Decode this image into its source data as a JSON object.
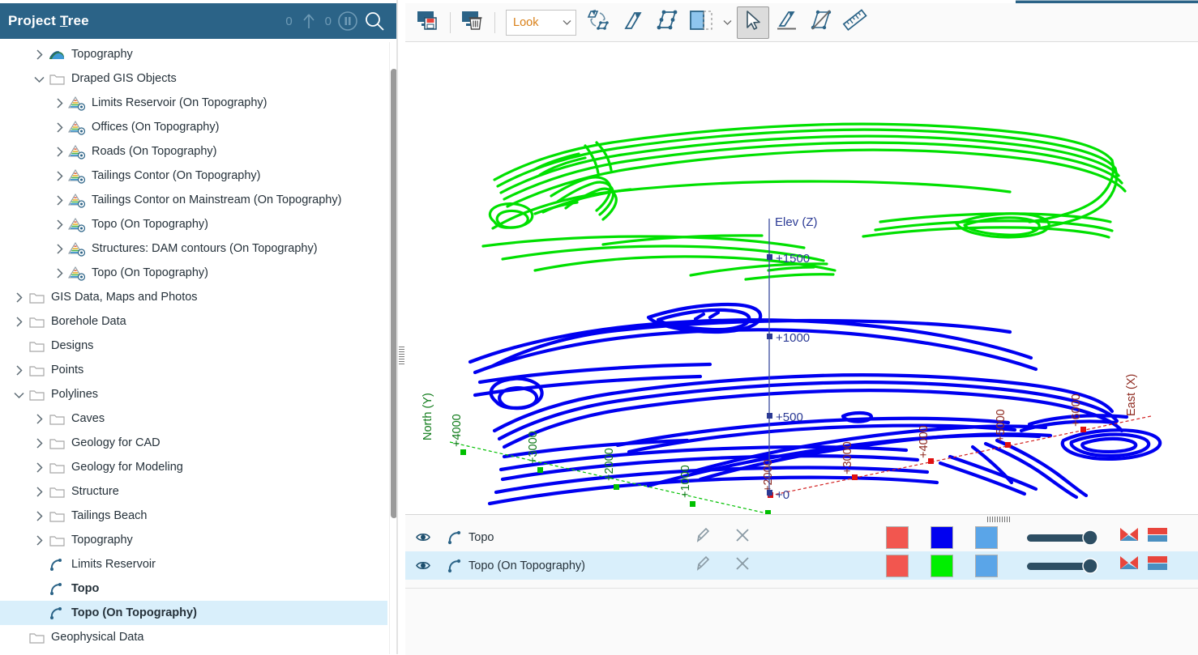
{
  "window": {
    "panel_title": "Project Tree",
    "panel_title_accel": "T"
  },
  "project_tree": {
    "counters": {
      "up_count": "0",
      "pause_count": "0"
    },
    "header_icons": [
      "upload-icon",
      "pause-icon",
      "search-icon"
    ],
    "items": [
      {
        "label": "Topography",
        "icon": "topography-icon",
        "indent": 1,
        "expander": "collapsed",
        "bold": false,
        "selected": false
      },
      {
        "label": "Draped GIS Objects",
        "icon": "folder-icon",
        "indent": 1,
        "expander": "expanded",
        "bold": false,
        "selected": false
      },
      {
        "label": "Limits Reservoir (On Topography)",
        "icon": "draped-gis-icon",
        "indent": 2,
        "expander": "collapsed",
        "bold": false,
        "selected": false
      },
      {
        "label": "Offices (On Topography)",
        "icon": "draped-gis-icon",
        "indent": 2,
        "expander": "collapsed",
        "bold": false,
        "selected": false
      },
      {
        "label": "Roads (On Topography)",
        "icon": "draped-gis-icon",
        "indent": 2,
        "expander": "collapsed",
        "bold": false,
        "selected": false
      },
      {
        "label": "Tailings Contor (On Topography)",
        "icon": "draped-gis-icon",
        "indent": 2,
        "expander": "collapsed",
        "bold": false,
        "selected": false
      },
      {
        "label": "Tailings Contor on Mainstream (On Topography)",
        "icon": "draped-gis-icon",
        "indent": 2,
        "expander": "collapsed",
        "bold": false,
        "selected": false
      },
      {
        "label": "Topo (On Topography)",
        "icon": "draped-gis-icon",
        "indent": 2,
        "expander": "collapsed",
        "bold": false,
        "selected": false
      },
      {
        "label": "Structures: DAM contours (On Topography)",
        "icon": "draped-gis-icon",
        "indent": 2,
        "expander": "collapsed",
        "bold": false,
        "selected": false
      },
      {
        "label": "Topo (On Topography)",
        "icon": "draped-gis-icon",
        "indent": 2,
        "expander": "collapsed",
        "bold": false,
        "selected": false
      },
      {
        "label": "GIS Data, Maps and Photos",
        "icon": "folder-icon",
        "indent": 0,
        "expander": "collapsed",
        "bold": false,
        "selected": false
      },
      {
        "label": "Borehole Data",
        "icon": "folder-icon",
        "indent": 0,
        "expander": "collapsed",
        "bold": false,
        "selected": false
      },
      {
        "label": "Designs",
        "icon": "folder-icon",
        "indent": 0,
        "expander": "none",
        "bold": false,
        "selected": false
      },
      {
        "label": "Points",
        "icon": "folder-icon",
        "indent": 0,
        "expander": "collapsed",
        "bold": false,
        "selected": false
      },
      {
        "label": "Polylines",
        "icon": "folder-icon",
        "indent": 0,
        "expander": "expanded",
        "bold": false,
        "selected": false
      },
      {
        "label": "Caves",
        "icon": "folder-icon",
        "indent": 1,
        "expander": "collapsed",
        "bold": false,
        "selected": false
      },
      {
        "label": "Geology for CAD",
        "icon": "folder-icon",
        "indent": 1,
        "expander": "collapsed",
        "bold": false,
        "selected": false
      },
      {
        "label": "Geology for Modeling",
        "icon": "folder-icon",
        "indent": 1,
        "expander": "collapsed",
        "bold": false,
        "selected": false
      },
      {
        "label": "Structure",
        "icon": "folder-icon",
        "indent": 1,
        "expander": "collapsed",
        "bold": false,
        "selected": false
      },
      {
        "label": "Tailings Beach",
        "icon": "folder-icon",
        "indent": 1,
        "expander": "collapsed",
        "bold": false,
        "selected": false
      },
      {
        "label": "Topography",
        "icon": "folder-icon",
        "indent": 1,
        "expander": "collapsed",
        "bold": false,
        "selected": false
      },
      {
        "label": "Limits Reservoir",
        "icon": "polyline-icon",
        "indent": 1,
        "expander": "none",
        "bold": false,
        "selected": false
      },
      {
        "label": "Topo",
        "icon": "polyline-icon",
        "indent": 1,
        "expander": "none",
        "bold": true,
        "selected": false
      },
      {
        "label": "Topo (On Topography)",
        "icon": "polyline-icon",
        "indent": 1,
        "expander": "none",
        "bold": true,
        "selected": true
      },
      {
        "label": "Geophysical Data",
        "icon": "folder-icon",
        "indent": 0,
        "expander": "none",
        "bold": false,
        "selected": false
      }
    ]
  },
  "toolbar": {
    "save_scene_view": "save-scene-view-icon",
    "delete_scene_view": "delete-scene-view-icon",
    "look_label": "Look",
    "buttons": [
      {
        "name": "reshape-polyline-icon",
        "pressed": false
      },
      {
        "name": "draw-polyline-icon",
        "pressed": false
      },
      {
        "name": "edit-polyline-nodes-icon",
        "pressed": false
      },
      {
        "name": "drawing-plane-icon",
        "pressed": false
      },
      {
        "name": "select-arrow-icon",
        "pressed": true
      },
      {
        "name": "draw-on-surface-icon",
        "pressed": false
      },
      {
        "name": "slice-polyline-icon",
        "pressed": false
      },
      {
        "name": "measure-ruler-icon",
        "pressed": false
      }
    ]
  },
  "viewport": {
    "axes": {
      "x": {
        "label": "East (X)",
        "color": "#c03030",
        "ticks": [
          "+2000",
          "+3000",
          "+4000",
          "+5000",
          "+6000"
        ]
      },
      "y": {
        "label": "North (Y)",
        "color": "#00b000",
        "ticks": [
          "+1000",
          "+2000",
          "+3000",
          "+4000"
        ]
      },
      "z": {
        "label": "Elev (Z)",
        "color": "#303a8c",
        "ticks": [
          "+0",
          "+500",
          "+1000",
          "+1500"
        ]
      },
      "origin_tick": "+0"
    },
    "objects": [
      {
        "name": "Topo (On Topography)",
        "color": "#00e000"
      },
      {
        "name": "Topo",
        "color": "#0000f0"
      }
    ]
  },
  "shape_list": {
    "rows": [
      {
        "name": "Topo",
        "visible": true,
        "icon": "polyline-icon",
        "edit_icon": "pencil-icon",
        "remove_icon": "close-icon",
        "swatch_1": "#f2564f",
        "swatch_2": "#0000f0",
        "swatch_3": "#5aa5e8",
        "opacity": 100,
        "selected": false
      },
      {
        "name": "Topo (On Topography)",
        "visible": true,
        "icon": "polyline-icon",
        "edit_icon": "pencil-icon",
        "remove_icon": "close-icon",
        "swatch_1": "#f2564f",
        "swatch_2": "#00ef00",
        "swatch_3": "#5aa5e8",
        "opacity": 100,
        "selected": true
      }
    ]
  },
  "colors": {
    "header_blue": "#2b6387",
    "selection_blue": "#d9effb",
    "icon_blue": "#2b6387",
    "accent_orange": "#d98018"
  }
}
